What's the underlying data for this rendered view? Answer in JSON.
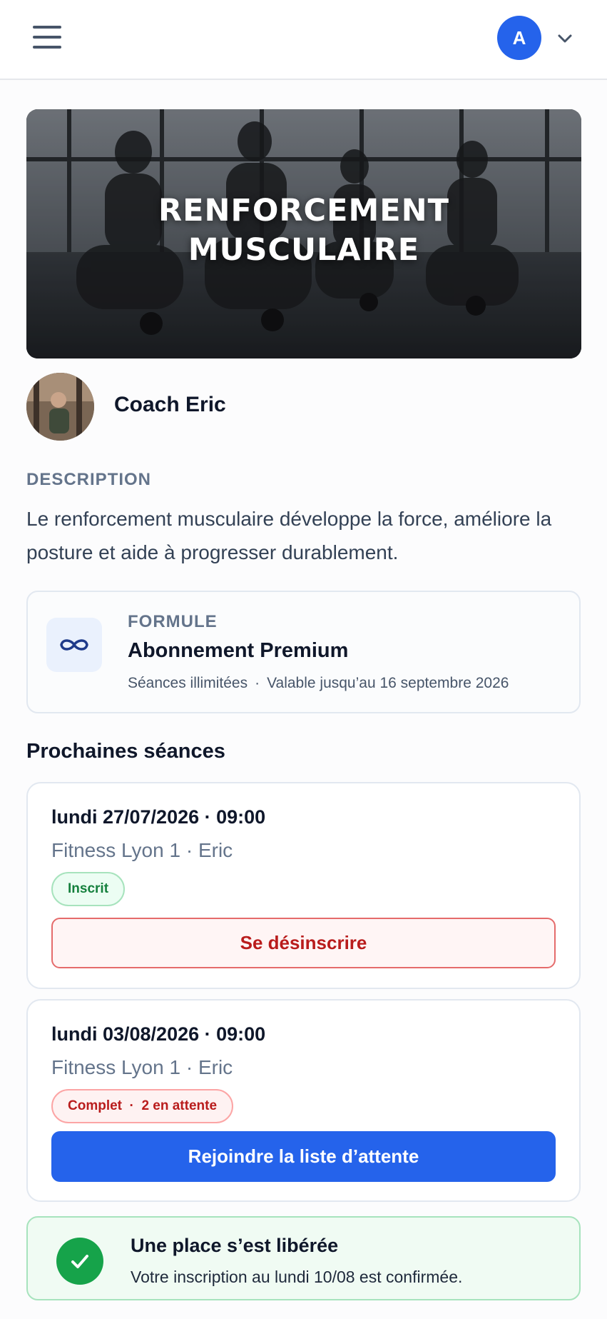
{
  "header": {
    "avatar_initial": "A"
  },
  "hero": {
    "title": "RENFORCEMENT MUSCULAIRE"
  },
  "coach": {
    "name": "Coach Eric"
  },
  "description": {
    "label": "DESCRIPTION",
    "text": "Le renforcement musculaire développe la force, améliore la posture et aide à progresser durablement."
  },
  "plan": {
    "label": "FORMULE",
    "name": "Abonnement Premium",
    "sessions": "Séances illimitées",
    "separator": "·",
    "validity": "Valable jusqu’au 16 septembre 2026"
  },
  "upcoming": {
    "title": "Prochaines séances",
    "sessions": [
      {
        "datetime": "lundi 27/07/2026 · 09:00",
        "place": "Fitness Lyon 1 · Eric",
        "badge": "Inscrit",
        "action": "Se désinscrire"
      },
      {
        "datetime": "lundi 03/08/2026 · 09:00",
        "place": "Fitness Lyon 1 · Eric",
        "badge": "Complet  ·  2 en attente",
        "action": "Rejoindre la liste d’attente"
      }
    ]
  },
  "notice": {
    "title": "Une place s’est libérée",
    "text": "Votre inscription au lundi 10/08 est confirmée."
  },
  "colors": {
    "primary": "#2563eb",
    "success": "#16a34a",
    "danger": "#b91c1c"
  }
}
